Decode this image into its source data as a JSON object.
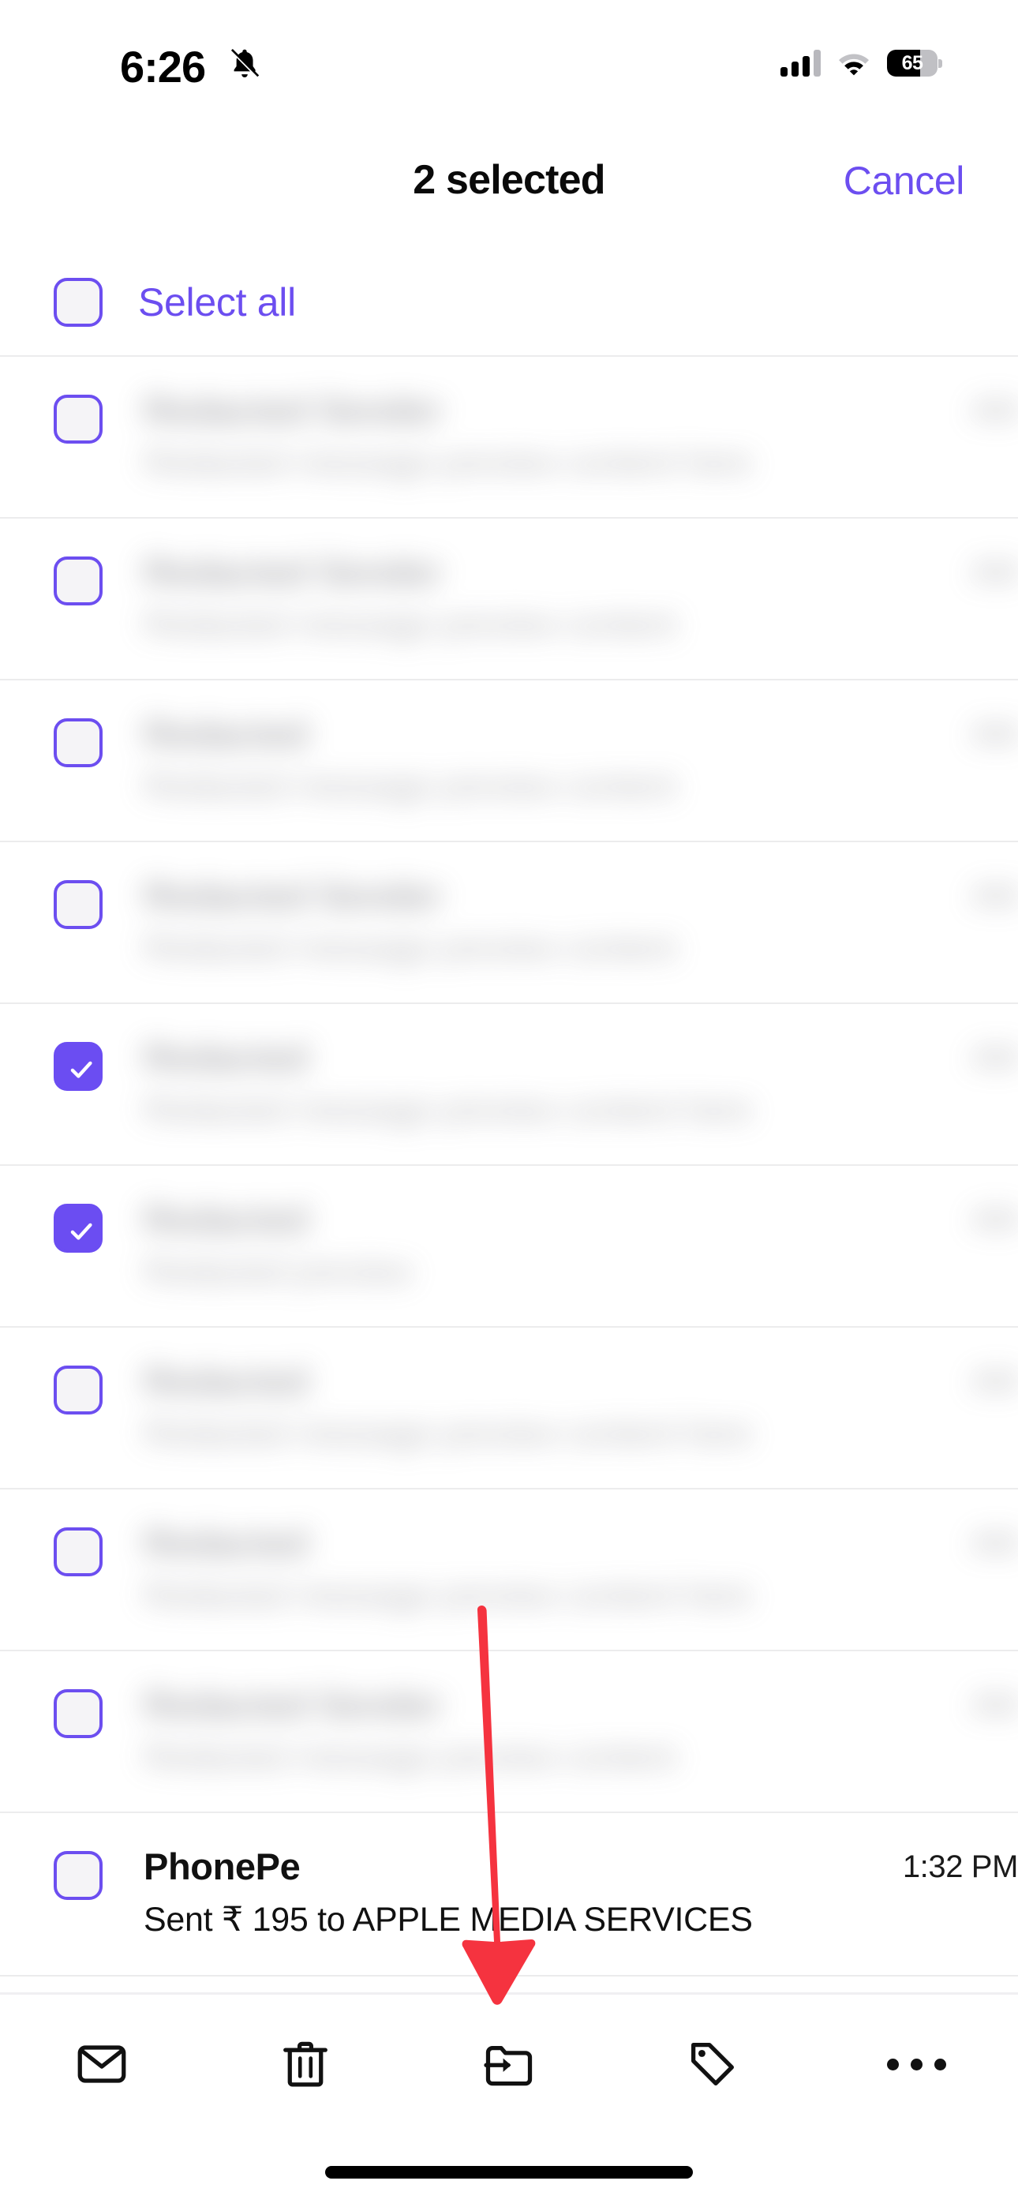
{
  "status_bar": {
    "time": "6:26",
    "silent_icon": "bell-slash-icon",
    "signal_icon": "cellular-signal-icon",
    "signal_bars_filled": 3,
    "signal_bars_total": 4,
    "wifi_icon": "wifi-icon",
    "battery_percent": "65",
    "battery_level": 65
  },
  "header": {
    "title": "2 selected",
    "selected_count": 2,
    "cancel_label": "Cancel"
  },
  "select_all": {
    "label": "Select all",
    "checked": false
  },
  "colors": {
    "accent_purple": "#6C4EF0",
    "checkbox_fill": "#6B4DF2",
    "checkbox_unchecked_bg": "#F5F4F7",
    "annotation_red": "#F5333F",
    "divider": "#ECECED",
    "text_primary": "#111111"
  },
  "mail_list": {
    "rows": [
      {
        "sender": "Redacted Sender",
        "time": "AM",
        "preview": "Redacted message preview content here",
        "checked": false,
        "blurred": true
      },
      {
        "sender": "Redacted Sender",
        "time": "AM",
        "preview": "Redacted message preview content",
        "checked": false,
        "blurred": true
      },
      {
        "sender": "Redacted",
        "time": "AM",
        "preview": "Redacted message preview content",
        "checked": false,
        "blurred": true
      },
      {
        "sender": "Redacted Sender",
        "time": "AM",
        "preview": "Redacted message preview content",
        "checked": false,
        "blurred": true
      },
      {
        "sender": "Redacted",
        "time": "AM",
        "preview": "Redacted message preview content here",
        "checked": true,
        "blurred": true
      },
      {
        "sender": "Redacted",
        "time": "AM",
        "preview": "Redacted preview",
        "checked": true,
        "blurred": true
      },
      {
        "sender": "Redacted",
        "time": "AM",
        "preview": "Redacted message preview content here",
        "checked": false,
        "blurred": true
      },
      {
        "sender": "Redacted",
        "time": "AM",
        "preview": "Redacted message preview content here",
        "checked": false,
        "blurred": true
      },
      {
        "sender": "Redacted Sender",
        "time": "AM",
        "preview": "Redacted message preview content",
        "checked": false,
        "blurred": true
      },
      {
        "sender": "PhonePe",
        "time": "1:32 PM",
        "preview": "Sent ₹ 195 to  APPLE MEDIA SERVICES",
        "checked": false,
        "blurred": false
      }
    ]
  },
  "toolbar": {
    "items": [
      {
        "icon": "envelope-icon",
        "name": "mark-unread-button"
      },
      {
        "icon": "trash-icon",
        "name": "delete-button"
      },
      {
        "icon": "move-to-folder-icon",
        "name": "move-button"
      },
      {
        "icon": "tag-icon",
        "name": "label-button"
      },
      {
        "icon": "more-dots-icon",
        "name": "more-button"
      }
    ]
  },
  "annotation": {
    "type": "arrow",
    "points_to": "move-to-folder-icon",
    "color": "#F5333F"
  }
}
